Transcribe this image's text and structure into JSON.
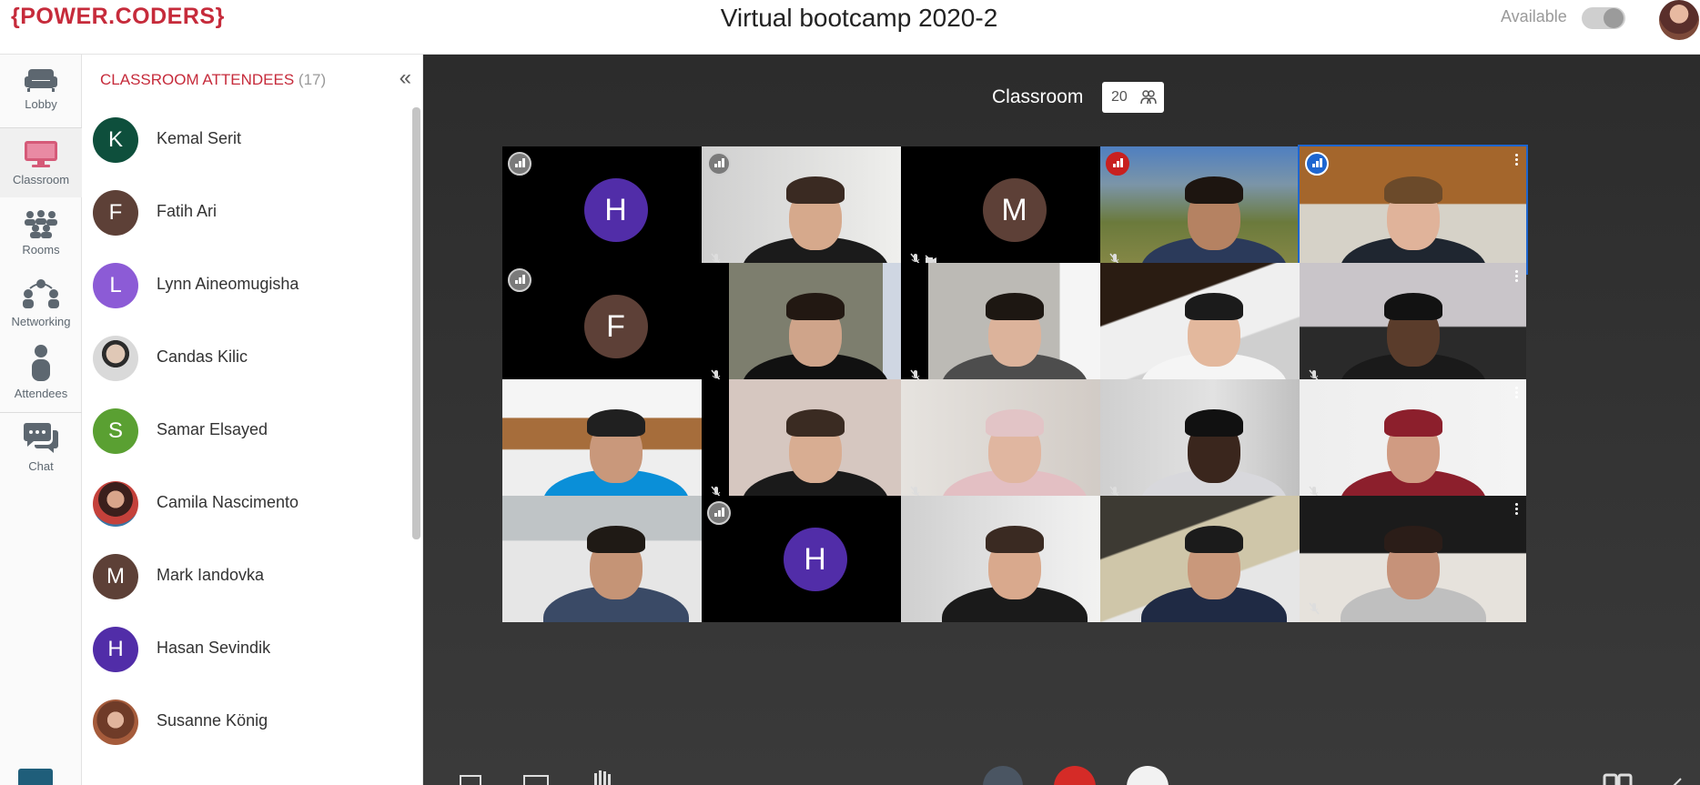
{
  "header": {
    "logo_left": "{",
    "logo_text": "POWER.CODERS",
    "logo_right": "}",
    "event_title": "Virtual bootcamp 2020-2",
    "status_label": "Available"
  },
  "nav": {
    "items": [
      {
        "label": "Lobby",
        "icon": "sofa-icon"
      },
      {
        "label": "Classroom",
        "icon": "monitor-icon"
      },
      {
        "label": "Rooms",
        "icon": "rooms-icon"
      },
      {
        "label": "Networking",
        "icon": "networking-icon"
      },
      {
        "label": "Attendees",
        "icon": "person-icon"
      },
      {
        "label": "Chat",
        "icon": "chat-icon"
      }
    ],
    "active": "Classroom"
  },
  "attendees": {
    "title": "CLASSROOM ATTENDEES",
    "count": "(17)",
    "list": [
      {
        "name": "Kemal Serit",
        "initial": "K",
        "color": "#0e4f3c"
      },
      {
        "name": "Fatih Ari",
        "initial": "F",
        "color": "#5d4037"
      },
      {
        "name": "Lynn Aineomugisha",
        "initial": "L",
        "color": "#8c5bd6"
      },
      {
        "name": "Candas Kilic",
        "initial": "",
        "color": "#b9b9b9"
      },
      {
        "name": "Samar Elsayed",
        "initial": "S",
        "color": "#5aa032"
      },
      {
        "name": "Camila Nascimento",
        "initial": "",
        "color": "#d46a5e"
      },
      {
        "name": "Mark Iandovka",
        "initial": "M",
        "color": "#5d4037"
      },
      {
        "name": "Hasan Sevindik",
        "initial": "H",
        "color": "#512da8"
      },
      {
        "name": "Susanne König",
        "initial": "",
        "color": "#8a4d3a"
      }
    ]
  },
  "stage": {
    "room_title": "Classroom",
    "room_count": "20",
    "tiles": [
      {
        "initial": "H",
        "avatar_color": "#512da8",
        "signal": "grey",
        "muted": false
      },
      {
        "initial": "",
        "signal": "grey",
        "muted": true,
        "scene": "woman-white-wall"
      },
      {
        "initial": "M",
        "avatar_color": "#5d4037",
        "signal": "none",
        "muted": true,
        "camoff": true,
        "star": true
      },
      {
        "initial": "",
        "signal": "red",
        "muted": true,
        "scene": "trees-outdoor"
      },
      {
        "initial": "",
        "signal": "blue",
        "muted": false,
        "scene": "wood-ceiling-man",
        "speaking": true
      },
      {
        "initial": "F",
        "avatar_color": "#5d4037",
        "signal": "grey",
        "muted": false
      },
      {
        "initial": "",
        "signal": "none",
        "muted": true,
        "scene": "flower-wall-man"
      },
      {
        "initial": "",
        "signal": "none",
        "muted": true,
        "scene": "man-white-room"
      },
      {
        "initial": "",
        "signal": "none",
        "muted": false,
        "scene": "attic-ceiling"
      },
      {
        "initial": "",
        "signal": "none",
        "muted": true,
        "scene": "man-dark"
      },
      {
        "initial": "",
        "signal": "none",
        "muted": false,
        "scene": "man-wood-ceiling"
      },
      {
        "initial": "",
        "signal": "none",
        "muted": true,
        "scene": "man-thinking"
      },
      {
        "initial": "",
        "signal": "none",
        "muted": true,
        "scene": "woman-hijab-pink"
      },
      {
        "initial": "",
        "signal": "none",
        "muted": true,
        "scene": "woman-kitchen"
      },
      {
        "initial": "",
        "signal": "none",
        "muted": true,
        "scene": "woman-hijab-red"
      },
      {
        "initial": "",
        "signal": "none",
        "muted": false,
        "scene": "man-reading"
      },
      {
        "initial": "H",
        "avatar_color": "#512da8",
        "signal": "grey",
        "muted": false
      },
      {
        "initial": "",
        "signal": "none",
        "muted": false,
        "scene": "woman-writing"
      },
      {
        "initial": "",
        "signal": "none",
        "muted": false,
        "scene": "man-glasses"
      },
      {
        "initial": "",
        "signal": "none",
        "muted": true,
        "scene": "woman-glasses"
      }
    ]
  },
  "colors": {
    "brand": "#c62b3b",
    "stage_bg": "#2f2f2f",
    "speaking": "#1e66d0"
  }
}
